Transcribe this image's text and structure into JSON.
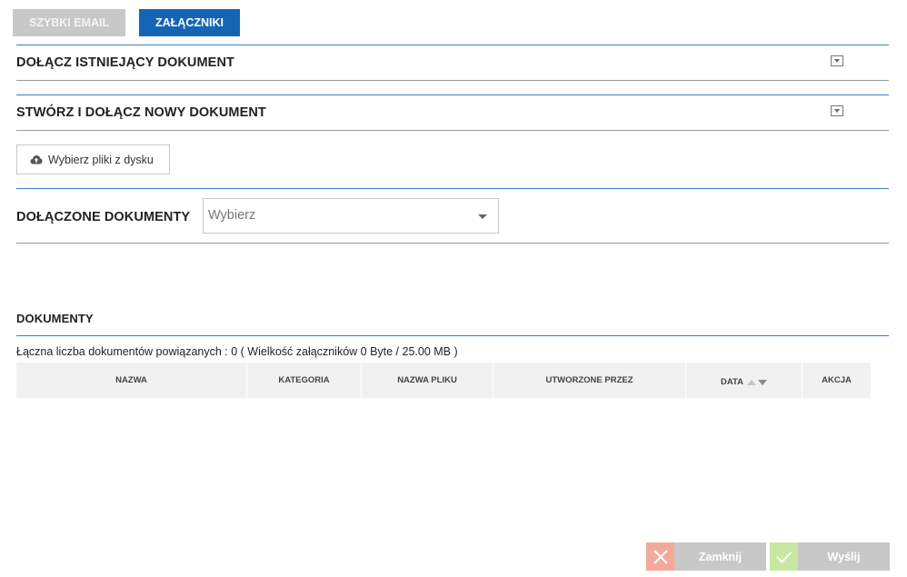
{
  "tabs": [
    {
      "label": "SZYBKI EMAIL",
      "active": false
    },
    {
      "label": "ZAŁĄCZNIKI",
      "active": true
    }
  ],
  "sections": {
    "attach_existing": "DOŁĄCZ ISTNIEJĄCY DOKUMENT",
    "create_new": "STWÓRZ I DOŁĄCZ NOWY DOKUMENT",
    "attached": "DOŁĄCZONE DOKUMENTY",
    "documents": "DOKUMENTY"
  },
  "upload": {
    "label": "Wybierz pliki z dysku",
    "icon": "cloud-upload-icon"
  },
  "select": {
    "placeholder": "Wybierz"
  },
  "summary": "Łączna liczba dokumentów powiązanych : 0 ( Wielkość załączników 0 Byte / 25.00 MB )",
  "table": {
    "columns": [
      "NAZWA",
      "KATEGORIA",
      "NAZWA PLIKU",
      "UTWORZONE PRZEZ",
      "DATA",
      "AKCJA"
    ],
    "rows": []
  },
  "footer": {
    "close_label": "Zamknij",
    "send_label": "Wyślij"
  },
  "colors": {
    "accent": "#1565b5",
    "section_line": "#3a7ec2",
    "close_icon_bg": "#f2a99a",
    "send_icon_bg": "#c8e7a0",
    "disabled_button": "#c8c8c8"
  }
}
